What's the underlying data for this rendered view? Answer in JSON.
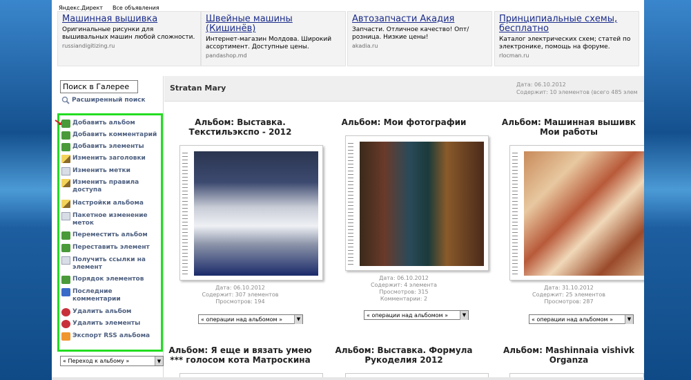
{
  "ads_header": {
    "link1": "Яндекс.Директ",
    "link2": "Все объявления"
  },
  "ads": [
    {
      "title": "Машинная вышивка",
      "text": "Оригинальные рисунки для вышивальных машин любой сложности.",
      "url": "russiandigitizing.ru"
    },
    {
      "title": "Швейные машины (Кишинёв)",
      "text": "Интернет-магазин Молдова. Широкий ассортимент. Доступные цены.",
      "url": "pandashop.md"
    },
    {
      "title": "Автозапчасти Акадия",
      "text": "Запчасти. Отличное качество! Опт/розница. Низкие цены!",
      "url": "akadia.ru"
    },
    {
      "title": "Принципиальные схемы, бесплатно",
      "text": "Каталог электрических схем; статей по электронике, помощь на форуме.",
      "url": "rlocman.ru"
    }
  ],
  "sidebar": {
    "search_value": "Поиск в Галерее",
    "advanced_search": "Расширенный поиск",
    "items": [
      {
        "label": "Добавить альбом",
        "icon": "add-album-icon"
      },
      {
        "label": "Добавить комментарий",
        "icon": "add-comment-icon"
      },
      {
        "label": "Добавить элементы",
        "icon": "add-items-icon"
      },
      {
        "label": "Изменить заголовки",
        "icon": "edit-captions-icon"
      },
      {
        "label": "Изменить метки",
        "icon": "edit-tags-icon"
      },
      {
        "label": "Изменить правила доступа",
        "icon": "permissions-icon"
      },
      {
        "label": "Настройки альбома",
        "icon": "album-settings-icon"
      },
      {
        "label": "Пакетное изменение меток",
        "icon": "batch-tags-icon"
      },
      {
        "label": "Переместить альбом",
        "icon": "move-album-icon"
      },
      {
        "label": "Переставить элемент",
        "icon": "reorder-item-icon"
      },
      {
        "label": "Получить ссылки на элемент",
        "icon": "get-links-icon"
      },
      {
        "label": "Порядок элементов",
        "icon": "item-order-icon"
      },
      {
        "label": "Последние комментарии",
        "icon": "recent-comments-icon"
      },
      {
        "label": "Удалить альбом",
        "icon": "delete-album-icon"
      },
      {
        "label": "Удалить элементы",
        "icon": "delete-items-icon"
      },
      {
        "label": "Экспорт RSS альбома",
        "icon": "rss-icon"
      }
    ],
    "goto_album": "« Переход к альбому »"
  },
  "gallery": {
    "title": "Stratan Mary",
    "meta_date": "Дата: 06.10.2012",
    "meta_contents": "Содержит: 10 элементов (всего 485 элем"
  },
  "albums": [
    {
      "title": "Альбом: Выставка.\nТекстильэкспо - 2012",
      "date": "Дата: 06.10.2012",
      "contents": "Содержит: 307 элементов",
      "views": "Просмотров: 194",
      "comments": "",
      "op_select": "« операции над альбомом »"
    },
    {
      "title": "Альбом: Мои фотографии",
      "date": "Дата: 06.10.2012",
      "contents": "Содержит: 4 элемента",
      "views": "Просмотров: 315",
      "comments": "Комментарии: 2",
      "op_select": "« операции над альбомом »"
    },
    {
      "title": "Альбом: Машинная вышивк\nМои работы",
      "date": "Дата: 31.10.2012",
      "contents": "Содержит: 25 элементов",
      "views": "Просмотров: 287",
      "comments": "",
      "op_select": "« операции над альбомом »"
    },
    {
      "title": "Альбом: Я еще и вязать умею\n*** голосом кота Матроскина"
    },
    {
      "title": "Альбом: Выставка. Формула\nРукоделия 2012"
    },
    {
      "title": "Альбом: Mashinnaia vishivk\nOrganza"
    }
  ],
  "colors": {
    "highlight_box": "#22dd22",
    "menu_text": "#4e6080",
    "ad_title": "#1a2b8a",
    "background": "#1a5da0"
  }
}
